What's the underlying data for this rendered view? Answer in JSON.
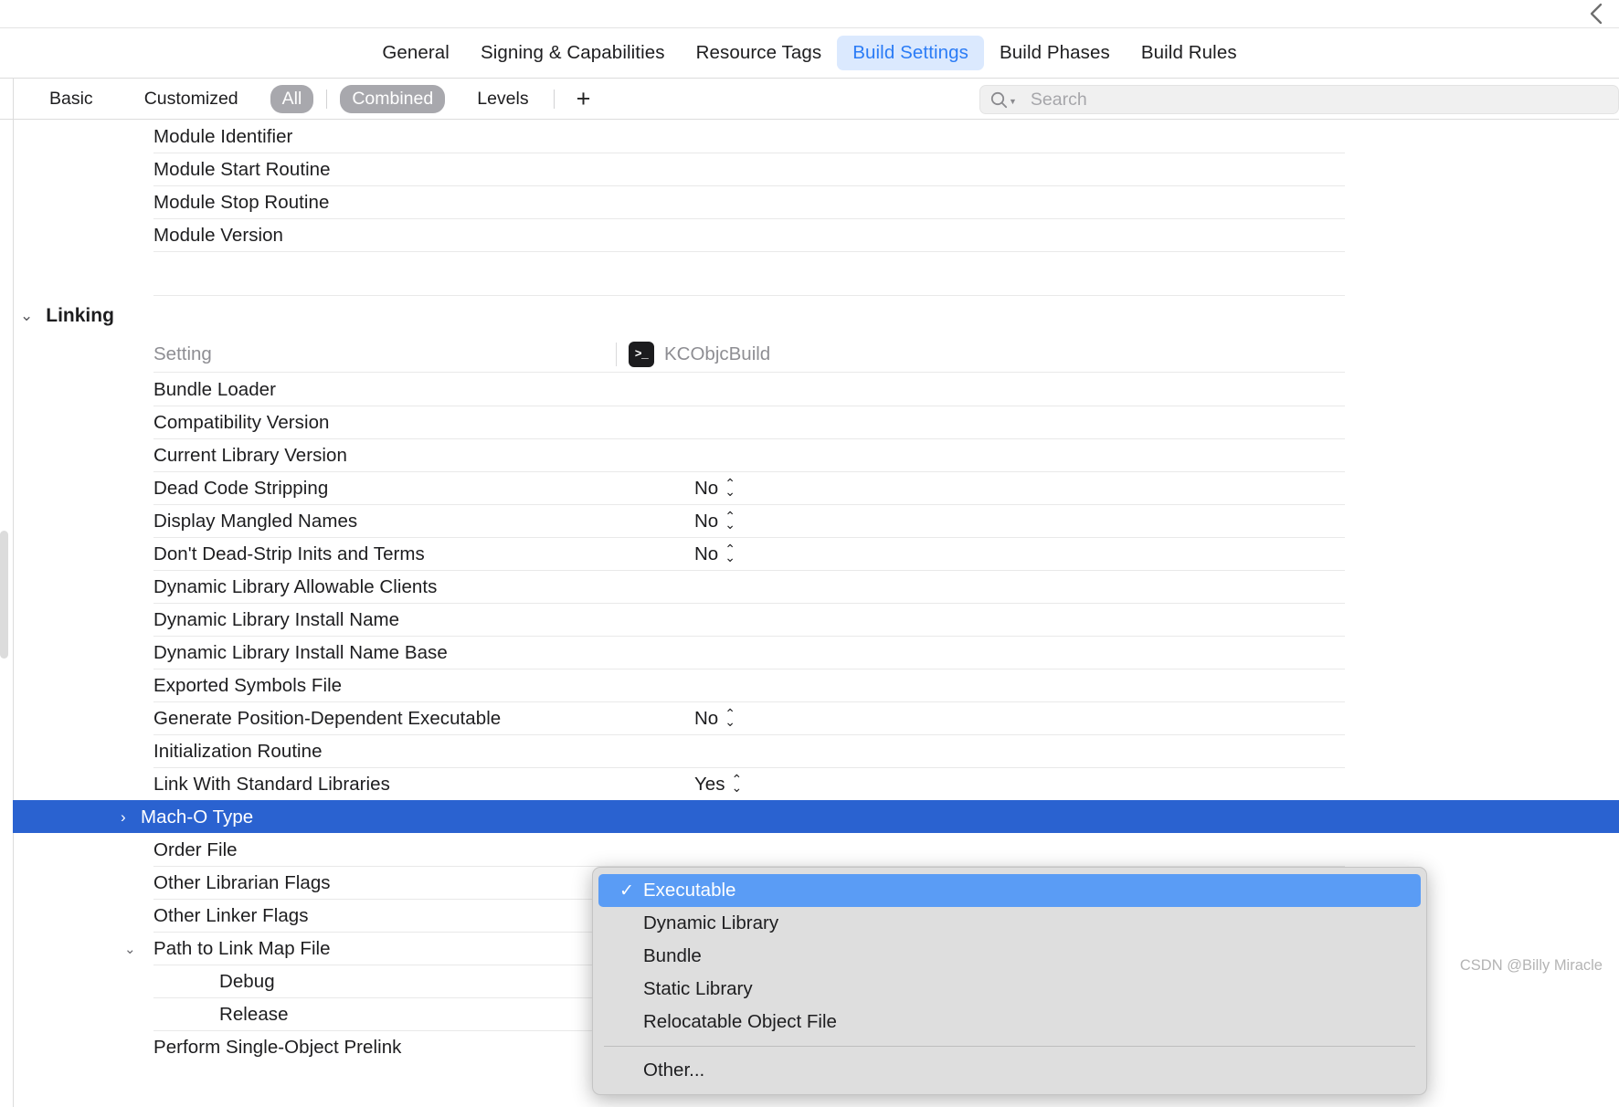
{
  "window": {
    "back_icon": "chevron-left-icon"
  },
  "tabs": [
    {
      "label": "General",
      "active": false
    },
    {
      "label": "Signing & Capabilities",
      "active": false
    },
    {
      "label": "Resource Tags",
      "active": false
    },
    {
      "label": "Build Settings",
      "active": true
    },
    {
      "label": "Build Phases",
      "active": false
    },
    {
      "label": "Build Rules",
      "active": false
    }
  ],
  "filterbar": {
    "basic": "Basic",
    "customized": "Customized",
    "all": "All",
    "combined": "Combined",
    "levels": "Levels",
    "add": "+",
    "selected_scope": "All",
    "selected_mode": "Combined"
  },
  "search": {
    "placeholder": "Search",
    "value": "",
    "icon": "search-icon"
  },
  "columns": {
    "setting_label": "Setting",
    "target_name": "KCObjcBuild",
    "target_icon": ">_"
  },
  "top_rows": [
    {
      "name": "Module Identifier",
      "value": ""
    },
    {
      "name": "Module Start Routine",
      "value": ""
    },
    {
      "name": "Module Stop Routine",
      "value": ""
    },
    {
      "name": "Module Version",
      "value": ""
    }
  ],
  "section": {
    "title": "Linking",
    "expanded": true
  },
  "linking_rows": [
    {
      "name": "Bundle Loader",
      "value": "",
      "type": "text"
    },
    {
      "name": "Compatibility Version",
      "value": "",
      "type": "text"
    },
    {
      "name": "Current Library Version",
      "value": "",
      "type": "text"
    },
    {
      "name": "Dead Code Stripping",
      "value": "No",
      "type": "popup"
    },
    {
      "name": "Display Mangled Names",
      "value": "No",
      "type": "popup"
    },
    {
      "name": "Don't Dead-Strip Inits and Terms",
      "value": "No",
      "type": "popup"
    },
    {
      "name": "Dynamic Library Allowable Clients",
      "value": "",
      "type": "text"
    },
    {
      "name": "Dynamic Library Install Name",
      "value": "",
      "type": "text"
    },
    {
      "name": "Dynamic Library Install Name Base",
      "value": "",
      "type": "text"
    },
    {
      "name": "Exported Symbols File",
      "value": "",
      "type": "text"
    },
    {
      "name": "Generate Position-Dependent Executable",
      "value": "No",
      "type": "popup"
    },
    {
      "name": "Initialization Routine",
      "value": "",
      "type": "text"
    },
    {
      "name": "Link With Standard Libraries",
      "value": "Yes",
      "type": "popup"
    }
  ],
  "selected_row": {
    "name": "Mach-O Type",
    "twisty": "›",
    "expanded": false
  },
  "after_rows": [
    {
      "name": "Order File",
      "value": "",
      "indent": false,
      "twisty": ""
    },
    {
      "name": "Other Librarian Flags",
      "value": "",
      "indent": false,
      "twisty": ""
    },
    {
      "name": "Other Linker Flags",
      "value": "",
      "indent": false,
      "twisty": ""
    },
    {
      "name": "Path to Link Map File",
      "value": "",
      "indent": false,
      "twisty": "⌄"
    },
    {
      "name": "Debug",
      "value": "",
      "indent": true,
      "twisty": ""
    },
    {
      "name": "Release",
      "value": "",
      "indent": true,
      "twisty": ""
    },
    {
      "name": "Perform Single-Object Prelink",
      "value": "",
      "indent": false,
      "twisty": ""
    }
  ],
  "popup_menu": {
    "items": [
      {
        "label": "Executable",
        "checked": true
      },
      {
        "label": "Dynamic Library",
        "checked": false
      },
      {
        "label": "Bundle",
        "checked": false
      },
      {
        "label": "Static Library",
        "checked": false
      },
      {
        "label": "Relocatable Object File",
        "checked": false
      }
    ],
    "other": "Other...",
    "check_glyph": "✓"
  },
  "watermark": "CSDN @Billy Miracle",
  "colors": {
    "accent_blue": "#2b7cf6",
    "tab_active_bg": "#dbe9fe",
    "row_selected": "#2a62d0",
    "menu_bg": "#dedede",
    "menu_highlight": "#5a9cf5",
    "segment_on": "#a8a8ad"
  }
}
